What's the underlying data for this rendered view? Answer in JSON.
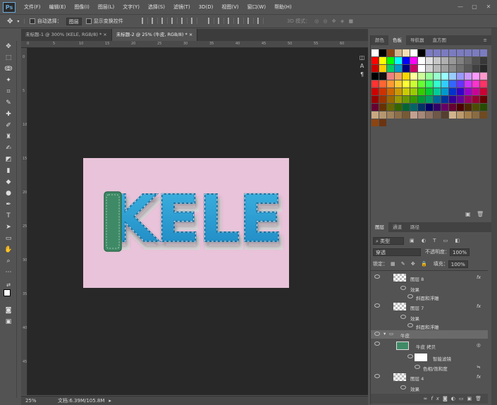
{
  "app": {
    "logo": "Ps"
  },
  "menu": [
    "文件(F)",
    "编辑(E)",
    "图像(I)",
    "图层(L)",
    "文字(Y)",
    "选择(S)",
    "滤镜(T)",
    "3D(D)",
    "视图(V)",
    "窗口(W)",
    "帮助(H)"
  ],
  "window_controls": [
    "—",
    "▢",
    "✕"
  ],
  "options": {
    "auto_select_label": "自动选择：",
    "auto_select_value": "图层",
    "show_transform_label": "显示变换控件",
    "mode_3d_label": "3D 模式："
  },
  "tabs": [
    {
      "label": "未标题-1 @ 300% (KELE, RGB/8) *",
      "close": "×"
    },
    {
      "label": "未标题-2 @ 25% (牛皮, RGB/8) *",
      "close": "×"
    }
  ],
  "rulers": {
    "h": [
      "0",
      "5",
      "10",
      "15",
      "20",
      "25",
      "30",
      "35",
      "40",
      "45",
      "50",
      "55",
      "60"
    ],
    "v": [
      "0",
      "5",
      "10",
      "15",
      "20",
      "25",
      "30",
      "35",
      "40",
      "45"
    ]
  },
  "canvas": {
    "word": "KELE",
    "bg_color": "#e8c3d9",
    "text_color": "#2aa0d0",
    "leather_color": "#3f8a66"
  },
  "status": {
    "zoom": "25%",
    "doc_size": "文档:6.39M/105.8M"
  },
  "color_panel": {
    "tabs": [
      "颜色",
      "色板",
      "导航器",
      "直方图"
    ],
    "active_tab": "色板"
  },
  "layers_panel": {
    "tabs": [
      "图层",
      "通道",
      "路径"
    ],
    "active_tab": "图层",
    "filter_kind": "类型",
    "blend_mode": "穿透",
    "opacity_label": "不透明度：",
    "opacity_value": "100%",
    "lock_label": "锁定：",
    "fill_label": "填充：",
    "fill_value": "100%",
    "layers": [
      {
        "name": "图层 8",
        "kind": "layer",
        "fx": "fx"
      },
      {
        "name": "效果",
        "kind": "effects"
      },
      {
        "name": "斜面和浮雕",
        "kind": "effect"
      },
      {
        "name": "图层 7",
        "kind": "layer",
        "fx": "fx"
      },
      {
        "name": "效果",
        "kind": "effects"
      },
      {
        "name": "斜面和浮雕",
        "kind": "effect"
      },
      {
        "name": "牛皮",
        "kind": "group"
      },
      {
        "name": "牛皮 拷贝",
        "kind": "smart"
      },
      {
        "name": "智能滤镜",
        "kind": "smartfilter"
      },
      {
        "name": "色相/饱和度",
        "kind": "filter"
      },
      {
        "name": "图层 4",
        "kind": "layer",
        "fx": "fx"
      },
      {
        "name": "效果",
        "kind": "effects"
      }
    ],
    "footer_icons": [
      "link-icon",
      "fx-icon",
      "mask-icon",
      "adjustment-icon",
      "folder-icon",
      "new-layer-icon",
      "trash-icon"
    ]
  },
  "swatch_colors": [
    [
      "#ffffff",
      "#000000",
      "#8b4513",
      "#d2b48c",
      "#f5deb3",
      "#ffffff",
      "#000000",
      "#7b7bc0",
      "#7b7bc0",
      "#7b7bc0",
      "#7b7bc0",
      "#7b7bc0",
      "#7b7bc0",
      "#7b7bc0",
      "#7b7bc0"
    ],
    [
      "#ff0000",
      "#ffff00",
      "#00ff00",
      "#00ffff",
      "#0000ff",
      "#ff00ff",
      "#ffffff",
      "#e0e0e0",
      "#c8c8c8",
      "#b0b0b0",
      "#989898",
      "#808080",
      "#686868",
      "#505050",
      "#383838"
    ],
    [
      "#cc0000",
      "#ffcc00",
      "#00cc66",
      "#0099cc",
      "#000080",
      "#cc0066",
      "#ffffff",
      "#d0d0d0",
      "#b8b8b8",
      "#a0a0a0",
      "#888888",
      "#707070",
      "#585858",
      "#404040",
      "#282828"
    ],
    [
      "#000000",
      "#111111",
      "#f08080",
      "#f4a460",
      "#ffd700",
      "#ffff99",
      "#ccff99",
      "#99ff99",
      "#99ffcc",
      "#99ffff",
      "#99ccff",
      "#9999ff",
      "#cc99ff",
      "#ff99ff",
      "#ff99cc"
    ],
    [
      "#ff3333",
      "#ff6633",
      "#ff9933",
      "#ffcc33",
      "#ffff33",
      "#ccff33",
      "#66ff33",
      "#33ff66",
      "#33ffcc",
      "#33ccff",
      "#3366ff",
      "#6633ff",
      "#cc33ff",
      "#ff33cc",
      "#ff3366"
    ],
    [
      "#cc0000",
      "#cc3300",
      "#cc6600",
      "#cc9900",
      "#cccc00",
      "#99cc00",
      "#33cc00",
      "#00cc33",
      "#00cc99",
      "#0099cc",
      "#0033cc",
      "#3300cc",
      "#9900cc",
      "#cc0099",
      "#cc0033"
    ],
    [
      "#990000",
      "#993300",
      "#996600",
      "#999900",
      "#669900",
      "#339900",
      "#009933",
      "#009966",
      "#006699",
      "#003399",
      "#330099",
      "#660099",
      "#990066",
      "#990033",
      "#660000"
    ],
    [
      "#660033",
      "#663300",
      "#666600",
      "#336600",
      "#006633",
      "#006666",
      "#003366",
      "#000066",
      "#330066",
      "#660066",
      "#660033",
      "#4d0000",
      "#4d2600",
      "#4d4d00",
      "#264d00"
    ],
    [
      "#c8a882",
      "#b49670",
      "#a0825c",
      "#8c6e48",
      "#785a34",
      "#c4a090",
      "#a88878",
      "#8c7060",
      "#705848",
      "#544030",
      "#d2b48c",
      "#bc9a6c",
      "#a6804c",
      "#8b6c42",
      "#704a20"
    ],
    [
      "#8b4513",
      "#6b3410"
    ]
  ]
}
